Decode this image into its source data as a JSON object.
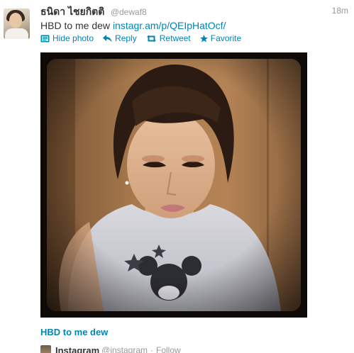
{
  "tweet": {
    "display_name": "ธนิดา ไชยกิตติ",
    "username": "@dewaf8",
    "timestamp": "18m",
    "text_prefix": "HBD to me dew ",
    "link": "instagr.am/p/QEIpHatOcf/"
  },
  "actions": {
    "hide_photo": "Hide photo",
    "reply": "Reply",
    "retweet": "Retweet",
    "favorite": "Favorite"
  },
  "media": {
    "caption": "HBD to me dew"
  },
  "attribution": {
    "name": "Instagram",
    "username": "@instagram",
    "separator": "·",
    "follow": "Follow"
  },
  "colors": {
    "link": "#0084b4",
    "muted": "#999999",
    "text": "#333333"
  },
  "icons": {
    "hide_photo": "photo-icon",
    "reply": "reply-arrow-icon",
    "retweet": "retweet-icon",
    "favorite": "star-icon"
  }
}
